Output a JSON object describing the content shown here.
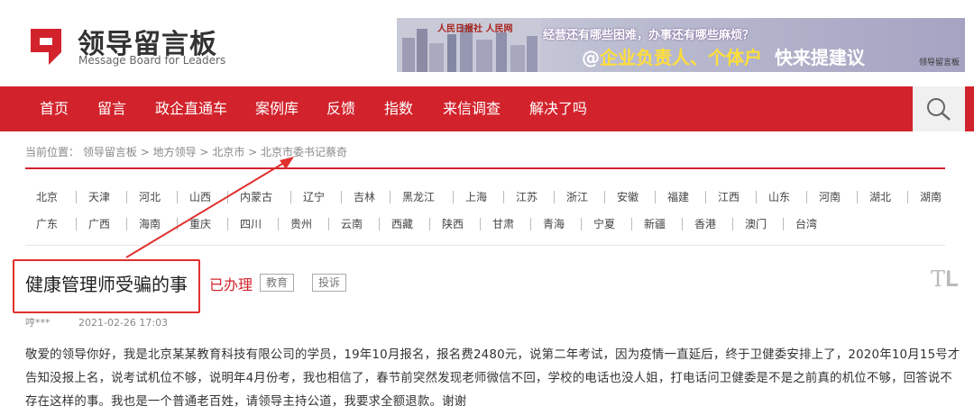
{
  "header": {
    "logo_cn": "领导留言板",
    "logo_en": "Message Board for Leaders"
  },
  "banner": {
    "brand": "人民日报社  人民网",
    "line1": "经营还有哪些困难，办事还有哪些麻烦？",
    "line2_prefix": "@",
    "line2_highlight": "企业负责人、个体户",
    "line2_suffix": "快来提建议",
    "tag": "领导留言板"
  },
  "nav": {
    "items": [
      {
        "label": "首页"
      },
      {
        "label": "留言"
      },
      {
        "label": "政企直通车"
      },
      {
        "label": "案例库"
      },
      {
        "label": "反馈"
      },
      {
        "label": "指数"
      },
      {
        "label": "来信调查"
      },
      {
        "label": "解决了吗"
      }
    ],
    "search_icon": "search-icon"
  },
  "breadcrumb": {
    "prefix": "当前位置：",
    "items": [
      "领导留言板",
      "地方领导",
      "北京市",
      "北京市委书记蔡奇"
    ],
    "separator": ">"
  },
  "regions": {
    "row1": [
      "北京",
      "天津",
      "河北",
      "山西",
      "内蒙古",
      "辽宁",
      "吉林",
      "黑龙江",
      "上海",
      "江苏",
      "浙江",
      "安徽",
      "福建",
      "江西",
      "山东",
      "河南",
      "湖北",
      "湖南"
    ],
    "row2": [
      "广东",
      "广西",
      "海南",
      "重庆",
      "四川",
      "贵州",
      "云南",
      "西藏",
      "陕西",
      "甘肃",
      "青海",
      "宁夏",
      "新疆",
      "香港",
      "澳门",
      "台湾"
    ]
  },
  "message": {
    "title": "健康管理师受骗的事",
    "status": "已办理",
    "tags": [
      "教育",
      "投诉"
    ],
    "author": "哼***",
    "time": "2021-02-26 17:03",
    "body": "敬爱的领导你好，我是北京某某教育科技有限公司的学员，19年10月报名，报名费2480元，说第二年考试，因为疫情一直延后，终于卫健委安排上了，2020年10月15号才告知没报上名，说考试机位不够，说明年4月份考，我也相信了，春节前突然发现老师微信不回，学校的电话也没人姐，打电话问卫健委是不是之前真的机位不够，回答说不存在这样的事。我也是一个普通老百姓，请领导主持公道，我要求全额退款。谢谢"
  },
  "colors": {
    "brand_red": "#d2232c",
    "annotation_red": "#e0302e"
  }
}
